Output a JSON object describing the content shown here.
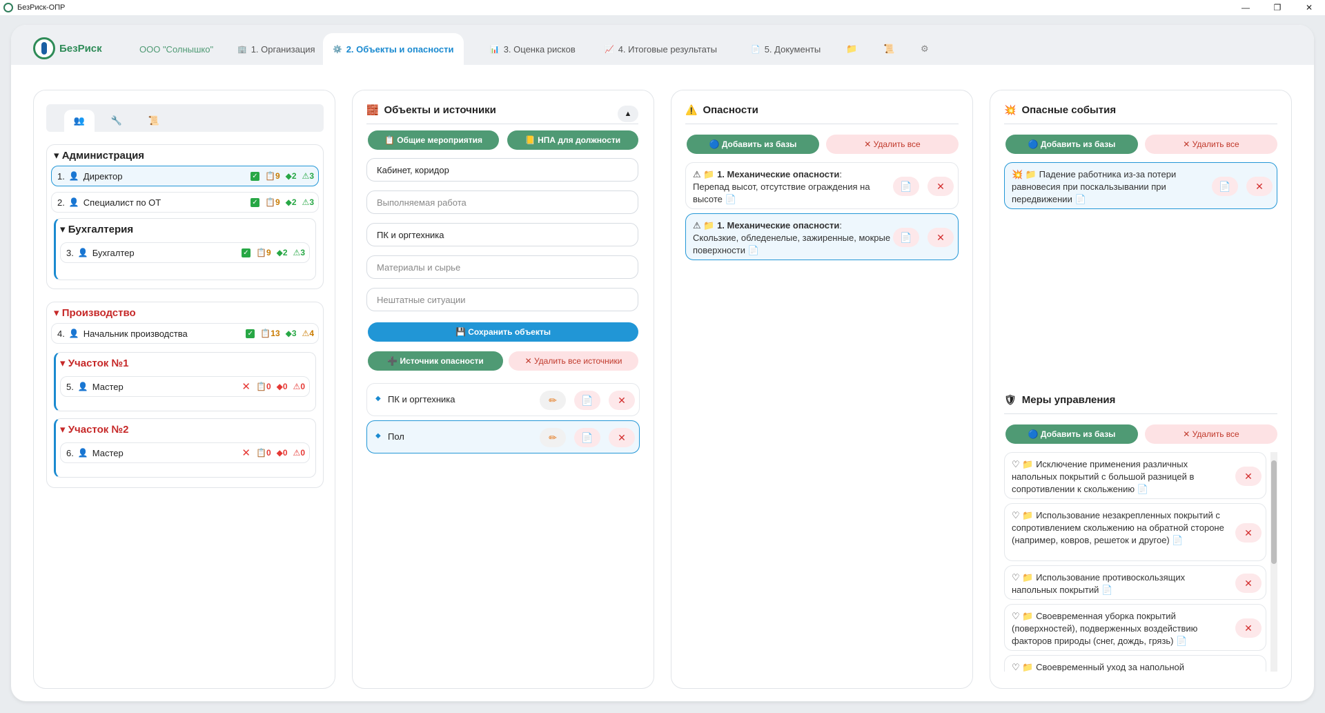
{
  "window": {
    "title": "БезРиск-ОПР",
    "minimize": "—",
    "maximize": "❐",
    "close": "✕"
  },
  "logo": {
    "text": "БезРиск"
  },
  "nav": {
    "company": "ООО \"Солнышко\"",
    "tabs": [
      {
        "icon": "🏢",
        "label": "1. Организация"
      },
      {
        "icon": "⚙️",
        "label": "2. Объекты и опасности"
      },
      {
        "icon": "📊",
        "label": "3. Оценка рисков"
      },
      {
        "icon": "📈",
        "label": "4. Итоговые результаты"
      },
      {
        "icon": "📄",
        "label": "5. Документы"
      }
    ],
    "extra_icons": [
      "📁",
      "📜",
      "⚙"
    ]
  },
  "tree": {
    "tab_icons": [
      "👥",
      "🔧",
      "📜"
    ],
    "groups": [
      {
        "name": "Администрация",
        "employees": [
          {
            "num": "1.",
            "name": "Директор",
            "status": "ok",
            "docs": "9",
            "sources": "2",
            "hazards": "3"
          },
          {
            "num": "2.",
            "name": "Специалист по ОТ",
            "status": "ok",
            "docs": "9",
            "sources": "2",
            "hazards": "3"
          }
        ],
        "subgroups": [
          {
            "name": "Бухгалтерия",
            "employees": [
              {
                "num": "3.",
                "name": "Бухгалтер",
                "status": "ok",
                "docs": "9",
                "sources": "2",
                "hazards": "3"
              }
            ]
          }
        ]
      },
      {
        "name": "Производство",
        "employees": [
          {
            "num": "4.",
            "name": "Начальник производства",
            "status": "ok",
            "docs": "13",
            "sources": "3",
            "hazards": "4"
          }
        ],
        "subgroups": [
          {
            "name": "Участок №1",
            "employees": [
              {
                "num": "5.",
                "name": "Мастер",
                "status": "bad",
                "docs": "0",
                "sources": "0",
                "hazards": "0"
              }
            ]
          },
          {
            "name": "Участок №2",
            "employees": [
              {
                "num": "6.",
                "name": "Мастер",
                "status": "bad",
                "docs": "0",
                "sources": "0",
                "hazards": "0"
              }
            ]
          }
        ]
      }
    ]
  },
  "objects": {
    "title": "Объекты и источники",
    "collapse": "▲",
    "btn_general": "Общие мероприятия",
    "btn_npa": "НПА для должности",
    "fields": [
      {
        "value": "Кабинет, коридор",
        "placeholder": ""
      },
      {
        "value": "",
        "placeholder": "Выполняемая работа"
      },
      {
        "value": "ПК и оргтехника",
        "placeholder": ""
      },
      {
        "value": "",
        "placeholder": "Материалы и сырье"
      },
      {
        "value": "",
        "placeholder": "Нештатные ситуации"
      }
    ],
    "btn_save": "Сохранить объекты",
    "btn_add_source": "Источник опасности",
    "btn_delete_sources": "Удалить все источники",
    "sources": [
      "ПК и оргтехника",
      "Пол"
    ]
  },
  "hazards": {
    "title": "Опасности",
    "btn_add": "Добавить из базы",
    "btn_delete": "Удалить все",
    "items": [
      {
        "head": "1. Механические опасности",
        "text": "Перепад высот, отсутствие ограждения на высоте"
      },
      {
        "head": "1. Механические опасности",
        "text": "Скользкие, обледенелые, зажиренные, мокрые поверхности"
      }
    ]
  },
  "events": {
    "title": "Опасные события",
    "btn_add": "Добавить из базы",
    "btn_delete": "Удалить все",
    "items": [
      "Падение работника из-за потери равновесия при поскальзывании при передвижении"
    ]
  },
  "measures": {
    "title": "Меры управления",
    "btn_add": "Добавить из базы",
    "btn_delete": "Удалить все",
    "items": [
      "Исключение применения различных напольных покрытий с большой разницей в сопротивлении к скольжению",
      "Использование незакрепленных покрытий с сопротивлением скольжению на обратной стороне (например, ковров, решеток и другое)",
      "Использование противоскользящих напольных покрытий",
      "Своевременная уборка покрытий (поверхностей), подверженных воздействию факторов природы (снег, дождь, грязь)",
      "Своевременный уход за напольной"
    ]
  },
  "colors": {
    "accent": "#2196d6",
    "green": "#4f9a74",
    "danger": "#e53935",
    "group_red": "#c62828"
  }
}
